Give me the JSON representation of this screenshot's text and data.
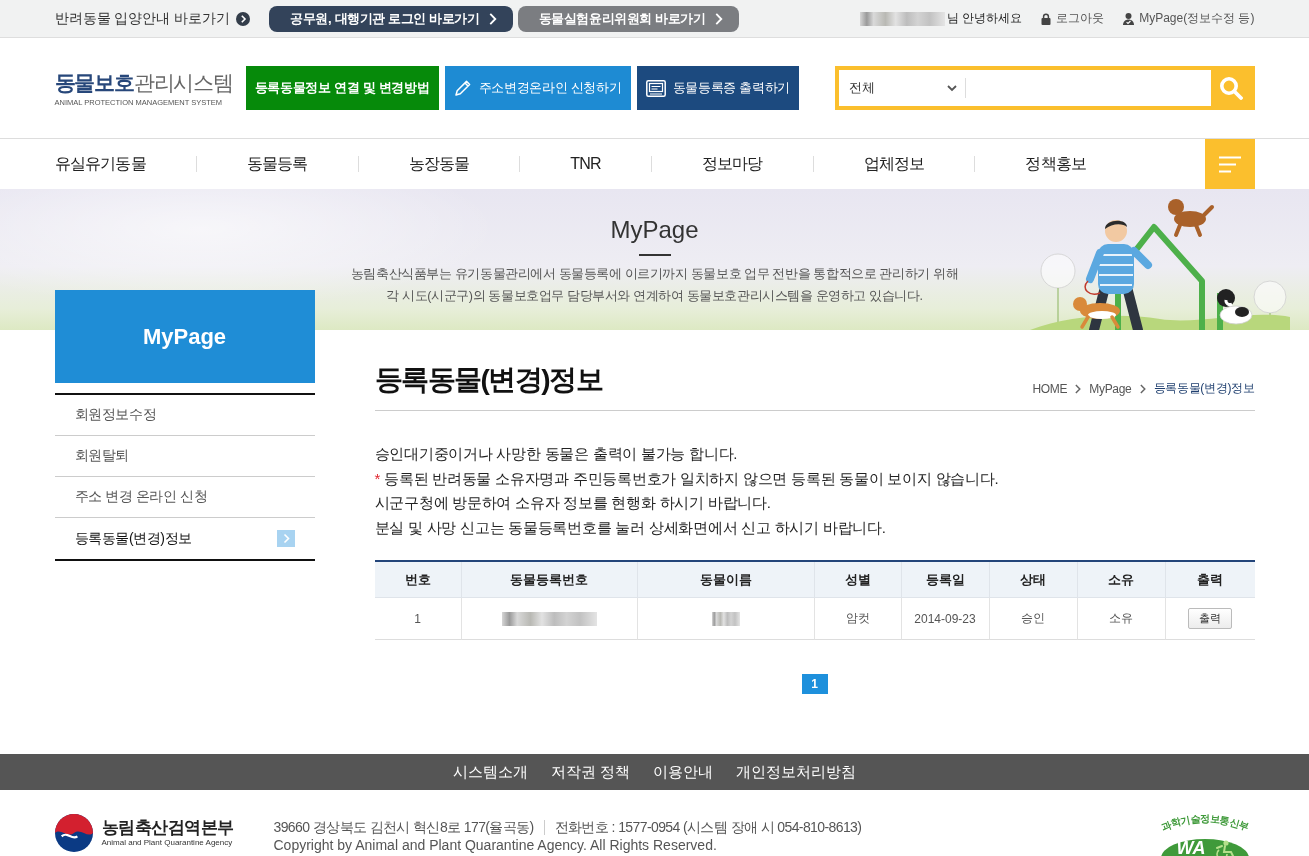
{
  "top_bar": {
    "adoption_link": "반려동물 입양안내 바로가기",
    "buttons": [
      {
        "label": "공무원, 대행기관 로그인 바로가기",
        "kind": "dark"
      },
      {
        "label": "동물실험윤리위원회 바로가기",
        "kind": "gray"
      }
    ],
    "user": {
      "name_hidden": true,
      "greeting": "님 안녕하세요"
    },
    "logout": "로그아웃",
    "mypage": "MyPage(정보수정 등)"
  },
  "header": {
    "logo": {
      "title": "**동물보호**관리시스템",
      "subtitle": "ANIMAL PROTECTION MANAGEMENT SYSTEM"
    },
    "quick_buttons": [
      {
        "label": "등록동물정보 연결 및 변경방법",
        "kind": "guide"
      },
      {
        "label": "주소변경온라인 신청하기",
        "kind": "address"
      },
      {
        "label": "동물등록증 출력하기",
        "kind": "certificate"
      }
    ],
    "search": {
      "scope": "전체"
    }
  },
  "nav": {
    "items": [
      "유실유기동물",
      "동물등록",
      "농장동물",
      "TNR",
      "정보마당",
      "업체정보",
      "정책홍보"
    ]
  },
  "banner": {
    "title": "MyPage",
    "description": [
      "농림축산식품부는 유기동물관리에서 동물등록에 이르기까지 동물보호 업무 전반을 통합적으로 관리하기 위해",
      "각 시도(시군구)의 동물보호업무 담당부서와 연계하여 동물보호관리시스템을 운영하고 있습니다."
    ]
  },
  "sidebar": {
    "title": "MyPage",
    "items": [
      {
        "label": "회원정보수정",
        "selected": false
      },
      {
        "label": "회원탈퇴",
        "selected": false
      },
      {
        "label": "주소 변경 온라인 신청",
        "selected": false
      },
      {
        "label": "등록동물(변경)정보",
        "selected": true
      }
    ]
  },
  "content": {
    "title": "등록동물(변경)정보",
    "breadcrumb": [
      {
        "label": "HOME",
        "current": false
      },
      {
        "label": "MyPage",
        "current": false
      },
      {
        "label": "등록동물(변경)정보",
        "current": true
      }
    ],
    "notes": [
      {
        "text": "승인대기중이거나 사망한 동물은 출력이 불가능 합니다."
      },
      {
        "marker": "*",
        "text": "등록된 반려동물 소유자명과 주민등록번호가 일치하지 않으면 등록된 동물이 보이지 않습니다."
      },
      {
        "text": "시군구청에 방문하여 소유자 정보를 현행화 하시기 바랍니다."
      },
      {
        "text": "분실 및 사망 신고는 동물등록번호를 눌러 상세화면에서 신고 하시기 바랍니다."
      }
    ]
  },
  "table": {
    "columns": [
      "번호",
      "동물등록번호",
      "동물이름",
      "성별",
      "등록일",
      "상태",
      "소유",
      "출력"
    ],
    "rows": [
      {
        "cells": [
          {
            "kind": "text",
            "text": "1"
          },
          {
            "kind": "hidden"
          },
          {
            "kind": "hidden"
          },
          {
            "kind": "text",
            "text": "암컷"
          },
          {
            "kind": "text",
            "text": "2014-09-23"
          },
          {
            "kind": "text",
            "text": "승인"
          },
          {
            "kind": "text",
            "text": "소유"
          },
          {
            "kind": "button",
            "text": "출력"
          }
        ]
      }
    ]
  },
  "pagination": {
    "pages": [
      {
        "label": "1",
        "selected": true
      }
    ]
  },
  "footer": {
    "links": [
      "시스템소개",
      "저작권 정책",
      "이용안내",
      "개인정보처리방침"
    ],
    "agency": {
      "name": "농림축산검역본부",
      "english": "Animal and Plant Quarantine Agency"
    },
    "address": "39660 경상북도 김천시 혁신8로 177(율곡동)",
    "phone": "전화번호 : 1577-0954 (시스템 장애 시 054-810-8613)",
    "copyright": "Copyright by Animal and Plant Quarantine Agency. All Rights Reserved.",
    "certification": {
      "authority": "과학기술정보통신부",
      "mark": "WA"
    }
  }
}
